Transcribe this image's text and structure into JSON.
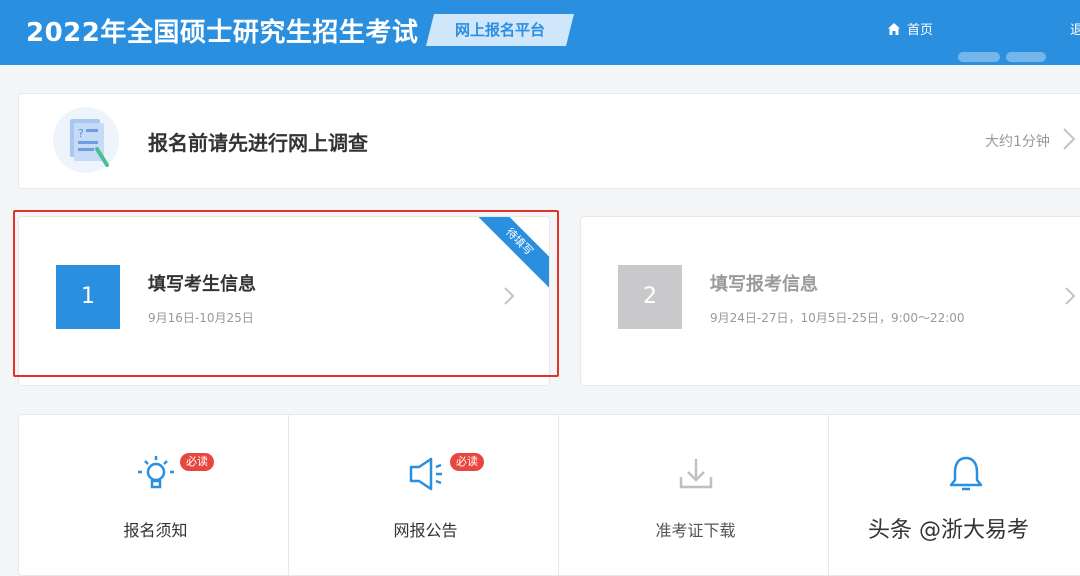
{
  "header": {
    "title": "2022年全国硕士研究生招生考试",
    "platform": "网上报名平台",
    "home": "首页",
    "exit": "退"
  },
  "survey": {
    "title": "报名前请先进行网上调查",
    "duration": "大约1分钟"
  },
  "steps": [
    {
      "number": "1",
      "title": "填写考生信息",
      "dates": "9月16日-10月25日",
      "ribbon": "待填写",
      "state": "active"
    },
    {
      "number": "2",
      "title": "填写报考信息",
      "dates": "9月24日-27日，10月5日-25日，9:00～22:00",
      "state": "disabled"
    }
  ],
  "tiles": [
    {
      "label": "报名须知",
      "badge": "必读",
      "icon": "lightbulb-icon"
    },
    {
      "label": "网报公告",
      "badge": "必读",
      "icon": "megaphone-icon"
    },
    {
      "label": "准考证下载",
      "icon": "download-icon"
    },
    {
      "label": "",
      "icon": "bell-icon"
    }
  ],
  "watermark": "头条 @浙大易考",
  "colors": {
    "primary": "#2b8fdf",
    "highlight": "#e0322b",
    "badge": "#e8473f",
    "disabled": "#c9c9cc"
  }
}
